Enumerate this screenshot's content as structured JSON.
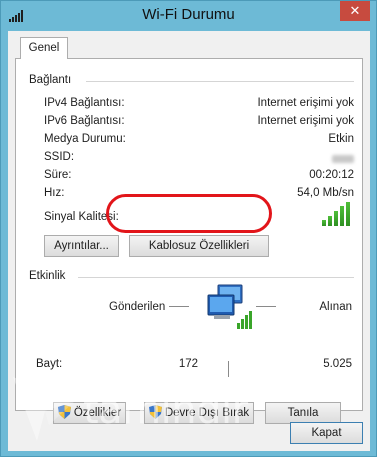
{
  "window": {
    "title": "Wi-Fi Durumu",
    "close_glyph": "✕"
  },
  "tabs": [
    {
      "label": "Genel"
    }
  ],
  "connection": {
    "group_title": "Bağlantı",
    "rows": [
      {
        "label": "IPv4 Bağlantısı:",
        "value": "Internet erişimi yok"
      },
      {
        "label": "IPv6 Bağlantısı:",
        "value": "Internet erişimi yok"
      },
      {
        "label": "Medya Durumu:",
        "value": "Etkin"
      },
      {
        "label": "SSID:",
        "value": ""
      },
      {
        "label": "Süre:",
        "value": "00:20:12"
      },
      {
        "label": "Hız:",
        "value": "54,0 Mb/sn"
      }
    ],
    "signal_label": "Sinyal Kalitesi:",
    "signal_bars": 5,
    "details_button": "Ayrıntılar...",
    "wireless_props_button": "Kablosuz Özellikleri"
  },
  "activity": {
    "group_title": "Etkinlik",
    "sent_label": "Gönderilen",
    "received_label": "Alınan",
    "bytes_label": "Bayt:",
    "bytes_sent": "172",
    "bytes_received": "5.025"
  },
  "buttons": {
    "properties": "Özellikler",
    "disable": "Devre Dışı Bırak",
    "diagnose": "Tanıla",
    "close": "Kapat"
  },
  "watermark": {
    "text": "tamindir"
  },
  "colors": {
    "titlebar": "#6dbad6",
    "close": "#c74b3f",
    "highlight": "#e2151a",
    "signal": "#3aa52a"
  }
}
